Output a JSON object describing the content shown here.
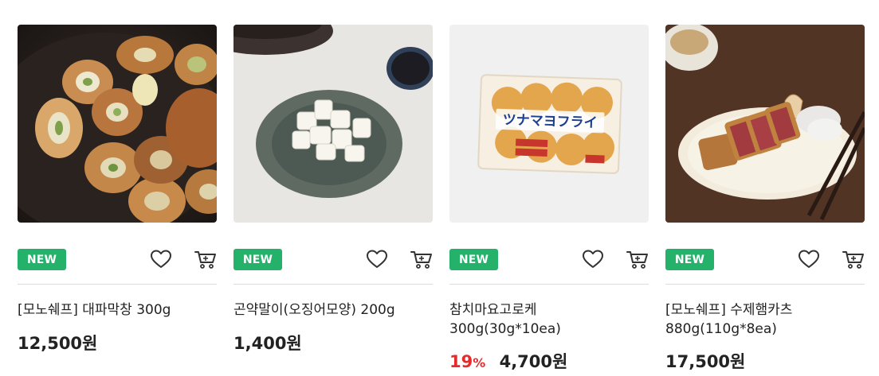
{
  "products": [
    {
      "badge": "NEW",
      "name": "[모노쉐프] 대파막창 300g",
      "price": "12,500원",
      "image": "grilled-green-onion-intestine-photo"
    },
    {
      "badge": "NEW",
      "name": "곤약말이(오징어모양) 200g",
      "price": "1,400원",
      "image": "konjac-rolls-plate-photo"
    },
    {
      "badge": "NEW",
      "name": "참치마요고로케 300g(30g*10ea)",
      "discount": "19",
      "discount_unit": "%",
      "price": "4,700원",
      "package_text": "ツナマヨフライ",
      "image": "tuna-mayo-croquette-package-photo"
    },
    {
      "badge": "NEW",
      "name": "[모노쉐프] 수제햄카츠 880g(110g*8ea)",
      "price": "17,500원",
      "image": "ham-katsu-plate-photo"
    }
  ],
  "colors": {
    "badge_bg": "#24b26b",
    "discount": "#e72b2b",
    "icon_stroke": "#333333",
    "divider": "#dcdcdc"
  },
  "icons": [
    "heart-icon",
    "cart-icon"
  ]
}
